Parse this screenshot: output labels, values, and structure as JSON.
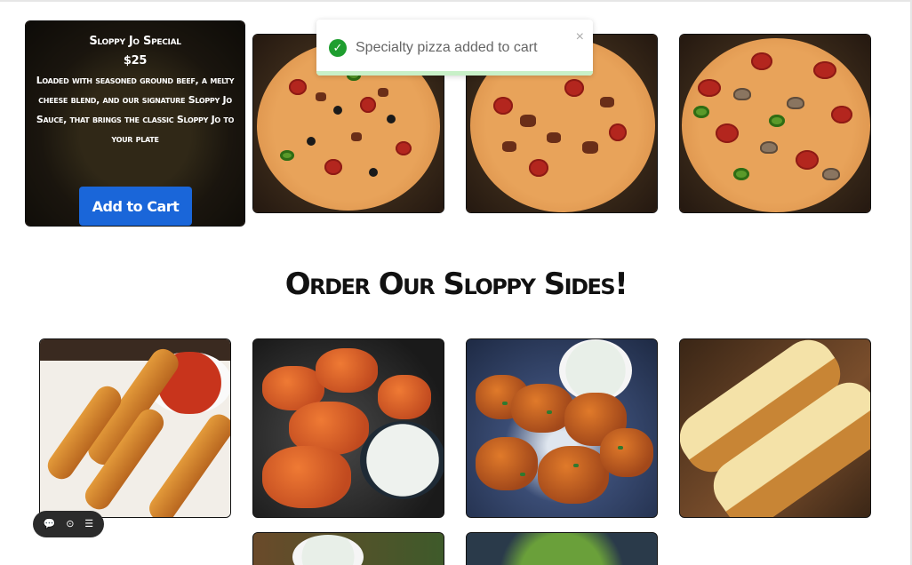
{
  "featured": {
    "title": "Sloppy Jo Special",
    "price": "$25",
    "description": "Loaded with seasoned ground beef, a melty cheese blend, and our signature Sloppy Jo Sauce, that brings the classic Sloppy Jo to your plate",
    "button_label": "Add to Cart"
  },
  "toast": {
    "icon": "check-circle-icon",
    "message": "Specialty pizza added to cart",
    "close_symbol": "×",
    "color": "#1e9e2f"
  },
  "sides_section": {
    "title": "Order Our Sloppy Sides!"
  },
  "colors": {
    "button_blue": "#1a66d9",
    "heading": "#111111"
  },
  "bottom_toolbar": {
    "icons": [
      "chat-bubble-icon",
      "toggle-icon",
      "menu-icon"
    ]
  }
}
